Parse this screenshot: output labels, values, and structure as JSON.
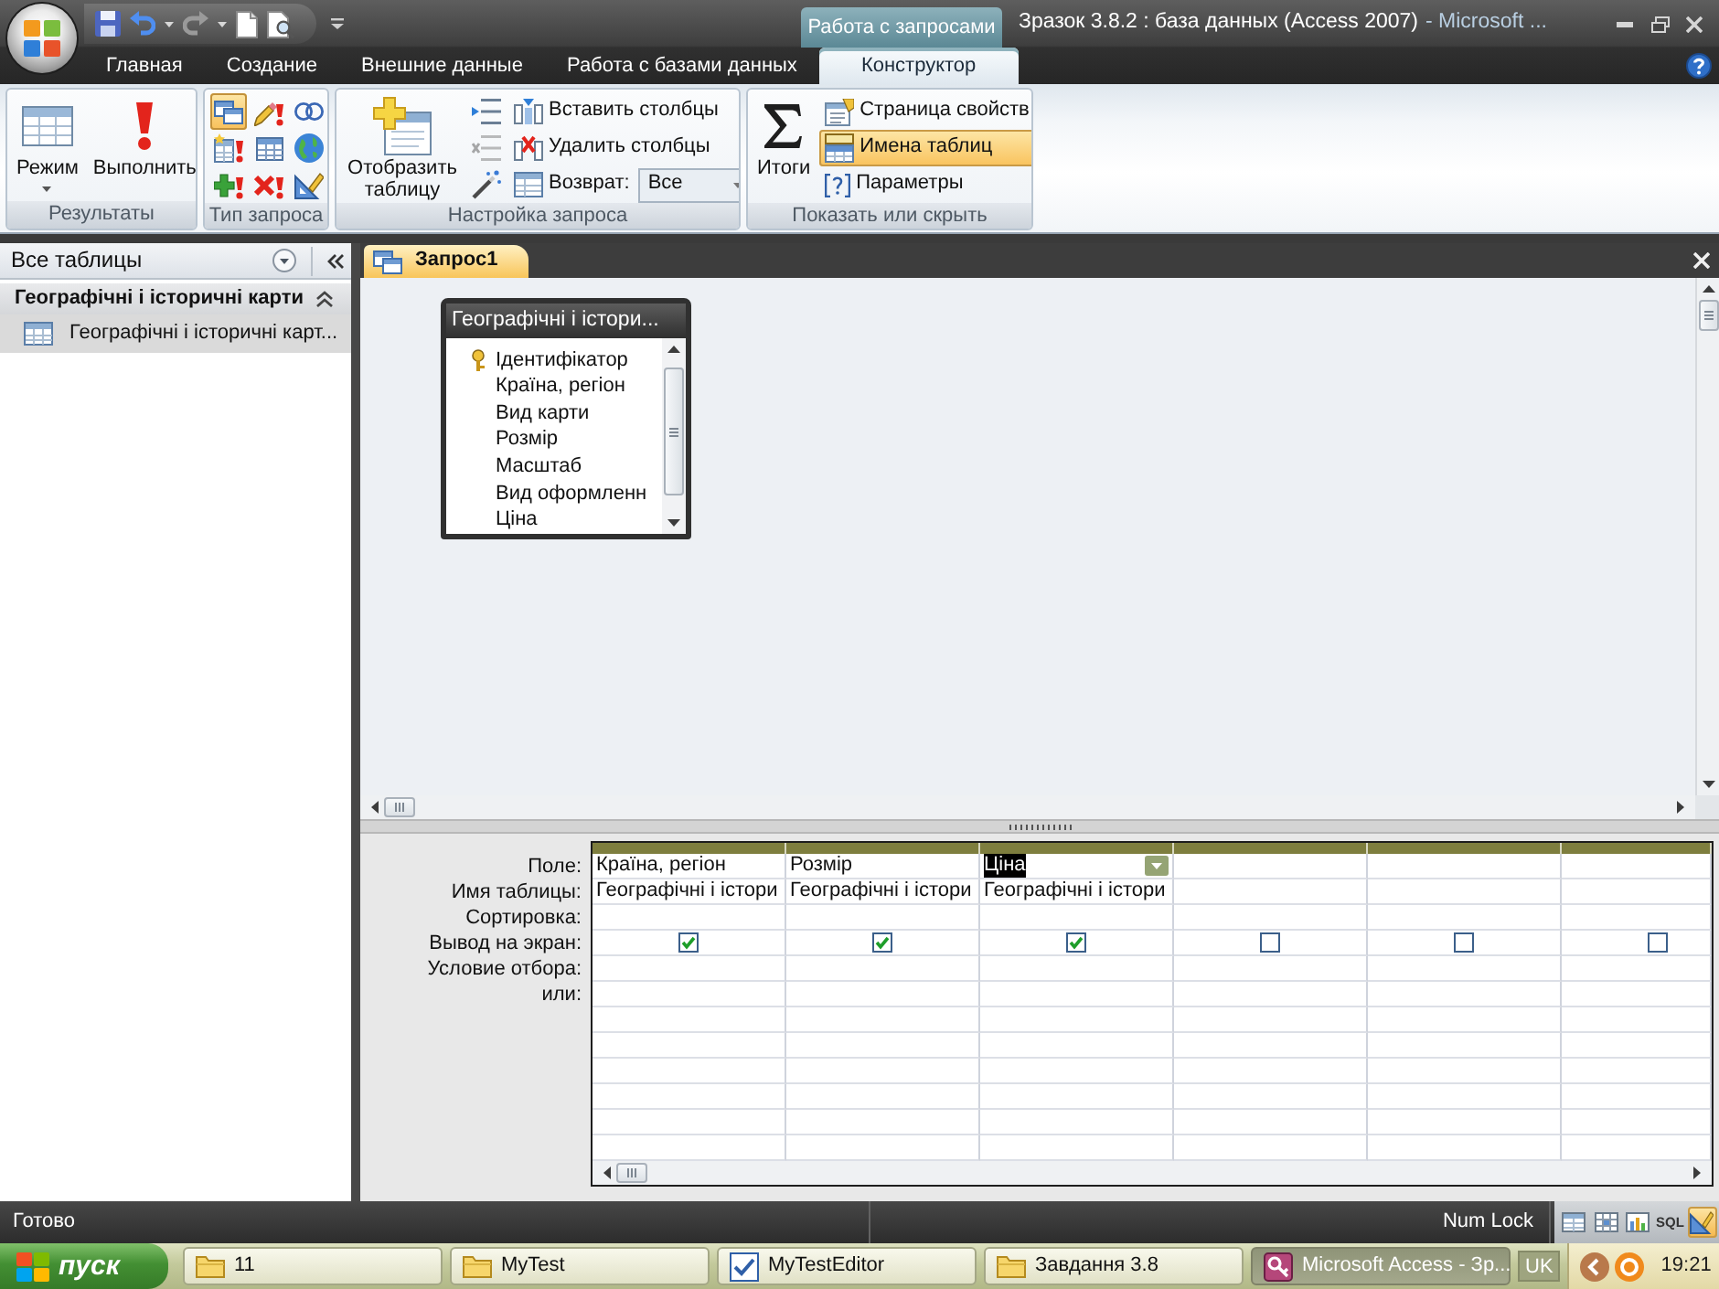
{
  "window": {
    "title": "Зразок 3.8.2 : база данных (Access 2007)",
    "app_name": "- Microsoft ...",
    "context_tab": "Работа с запросами"
  },
  "ribbon_tabs": [
    {
      "label": "Главная",
      "selected": false
    },
    {
      "label": "Создание",
      "selected": false
    },
    {
      "label": "Внешние данные",
      "selected": false
    },
    {
      "label": "Работа с базами данных",
      "selected": false
    },
    {
      "label": "Конструктор",
      "selected": true
    }
  ],
  "ribbon": {
    "results": {
      "label": "Результаты",
      "buttons": [
        {
          "label": "Режим",
          "dropdown": true
        },
        {
          "label": "Выполнить",
          "dropdown": false
        }
      ]
    },
    "query_type": {
      "label": "Тип запроса",
      "buttons": [
        {
          "selected": true
        },
        {
          "selected": false
        },
        {
          "selected": false
        },
        {
          "selected": false
        },
        {
          "selected": false
        },
        {
          "selected": false
        },
        {
          "selected": false
        },
        {
          "selected": false
        },
        {
          "selected": false
        }
      ]
    },
    "query_setup": {
      "label": "Настройка запроса",
      "show_table": "Отобразить таблицу",
      "row_tools": [
        {
          "disabled": false
        },
        {
          "disabled": true
        },
        {
          "disabled": false
        }
      ],
      "column_tools": [
        {
          "label": "Вставить столбцы"
        },
        {
          "label": "Удалить столбцы"
        }
      ],
      "return": {
        "label": "Возврат:",
        "value": "Все"
      }
    },
    "show_hide": {
      "label": "Показать или скрыть",
      "totals": "Итоги",
      "toggles": [
        {
          "label": "Страница свойств",
          "selected": false
        },
        {
          "label": "Имена таблиц",
          "selected": true
        },
        {
          "label": "Параметры",
          "selected": false
        }
      ]
    }
  },
  "navigation": {
    "title": "Все таблицы",
    "groups": [
      {
        "label": "Географічні і історичні карти",
        "expanded": true,
        "items": [
          {
            "label": "Географічні і історичні карт...",
            "selected": true
          }
        ]
      }
    ]
  },
  "document_tabs": [
    {
      "label": "Запрос1",
      "selected": true
    }
  ],
  "query_tables": [
    {
      "title": "Географічні і істори...",
      "fields": [
        {
          "label": "Ідентифікатор",
          "primary_key": true
        },
        {
          "label": "Країна, регіон",
          "primary_key": false
        },
        {
          "label": "Вид карти",
          "primary_key": false
        },
        {
          "label": "Розмір",
          "primary_key": false
        },
        {
          "label": "Масштаб",
          "primary_key": false
        },
        {
          "label": "Вид оформленн",
          "primary_key": false
        },
        {
          "label": "Ціна",
          "primary_key": false
        }
      ]
    }
  ],
  "design_grid": {
    "row_labels": [
      "Поле:",
      "Имя таблицы:",
      "Сортировка:",
      "Вывод на экран:",
      "Условие отбора:",
      "или:"
    ],
    "columns": [
      {
        "field": "Країна, регіон",
        "table": "Географічні і істори",
        "show": true,
        "selected": false
      },
      {
        "field": "Розмір",
        "table": "Географічні і істори",
        "show": true,
        "selected": false
      },
      {
        "field": "Ціна",
        "table": "Географічні і істори",
        "show": true,
        "selected": true
      },
      {
        "show": false,
        "selected": false
      },
      {
        "show": false,
        "selected": false
      },
      {
        "show": false,
        "selected": false
      }
    ]
  },
  "status_bar": {
    "text": "Готово",
    "indicator": "Num Lock",
    "views": [
      {
        "selected": false
      },
      {
        "selected": false
      },
      {
        "selected": false
      },
      {
        "label": "SQL",
        "selected": false
      },
      {
        "selected": true
      }
    ]
  },
  "taskbar": {
    "start": "пуск",
    "tasks": [
      {
        "label": "11",
        "kind": "folder",
        "selected": false
      },
      {
        "label": "MyTest",
        "kind": "folder",
        "selected": false
      },
      {
        "label": "MyTestEditor",
        "kind": "editor",
        "selected": false
      },
      {
        "label": "Завдання 3.8",
        "kind": "folder",
        "selected": false
      },
      {
        "label": "Microsoft Access - Зр...",
        "kind": "access",
        "selected": true
      }
    ],
    "language": "UK",
    "clock": "19:21"
  }
}
